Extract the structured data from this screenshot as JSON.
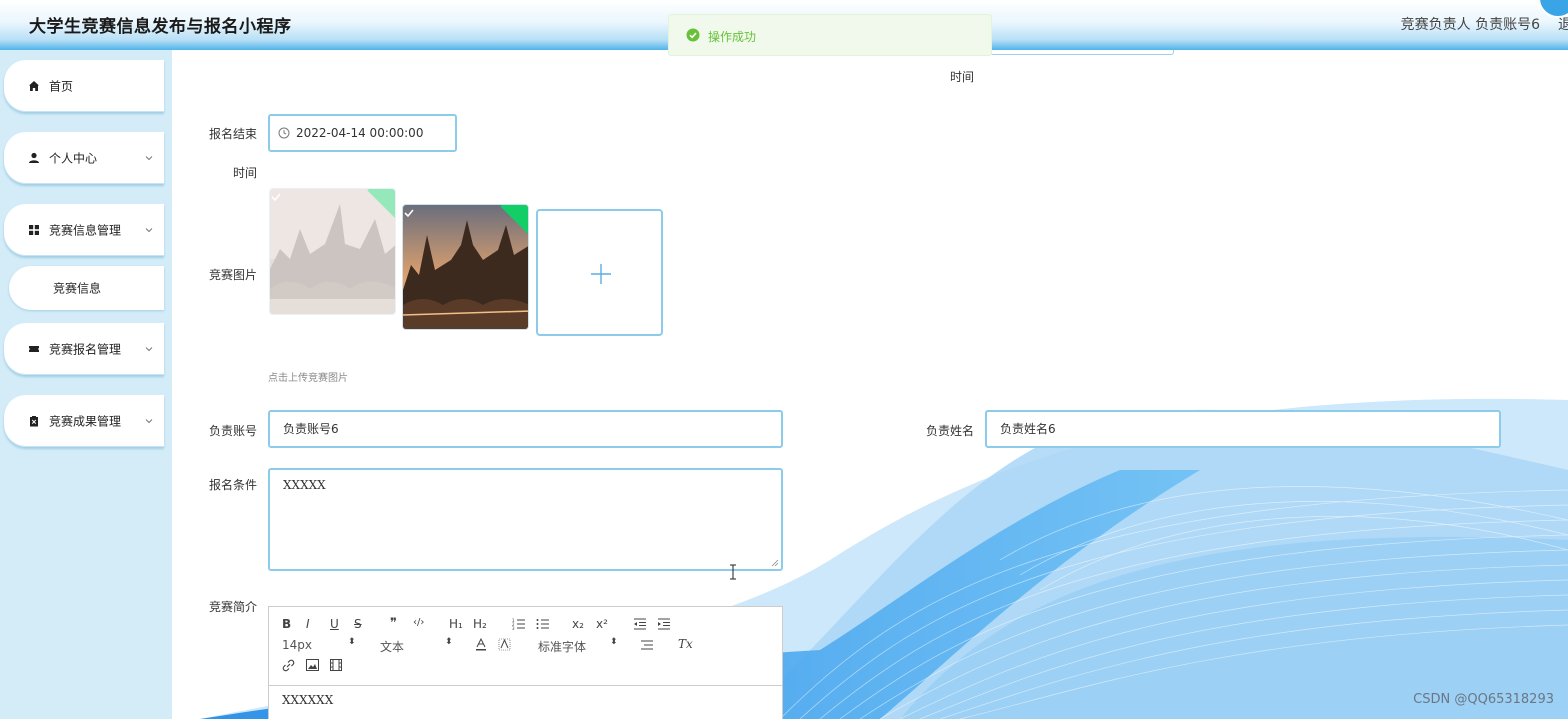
{
  "header": {
    "app_title": "大学生竞赛信息发布与报名小程序",
    "user_role": "竞赛负责人",
    "user_account": "负责账号6",
    "logout_partial": "退"
  },
  "toast": {
    "message": "操作成功",
    "icon": "success-circle-icon"
  },
  "sidebar": {
    "items": [
      {
        "label": "首页",
        "icon": "home-icon"
      },
      {
        "label": "个人中心",
        "icon": "user-icon"
      },
      {
        "label": "竞赛信息管理",
        "icon": "grid-icon"
      },
      {
        "label": "竞赛报名管理",
        "icon": "ticket-icon"
      },
      {
        "label": "竞赛成果管理",
        "icon": "clipboard-icon"
      }
    ],
    "subitem": {
      "label": "竞赛信息"
    }
  },
  "form": {
    "top_time_label": "时间",
    "end_label_line1": "报名结束",
    "end_label_line2": "时间",
    "end_time_value": "2022-04-14 00:00:00",
    "image_label": "竞赛图片",
    "upload_hint": "点击上传竞赛图片",
    "account_label": "负责账号",
    "account_value": "负责账号6",
    "name_label": "负责姓名",
    "name_value": "负责姓名6",
    "condition_label": "报名条件",
    "condition_value": "XXXXX",
    "intro_label": "竞赛简介",
    "intro_value": "XXXXXX"
  },
  "editor_toolbar": {
    "bold": "B",
    "italic": "I",
    "underline": "U",
    "strike": "S",
    "quote": "❞",
    "code": "‹/›",
    "h1": "H₁",
    "h2": "H₂",
    "sub": "x₂",
    "sup": "x²",
    "size": "14px",
    "header_select": "文本",
    "font_select": "标准字体",
    "clear": "Tx"
  },
  "watermark": "CSDN @QQ65318293",
  "colors": {
    "accent": "#3aa5e6",
    "border": "#8ccbe9",
    "success": "#67c23a",
    "sidebar_bg": "#d3ecf8"
  }
}
